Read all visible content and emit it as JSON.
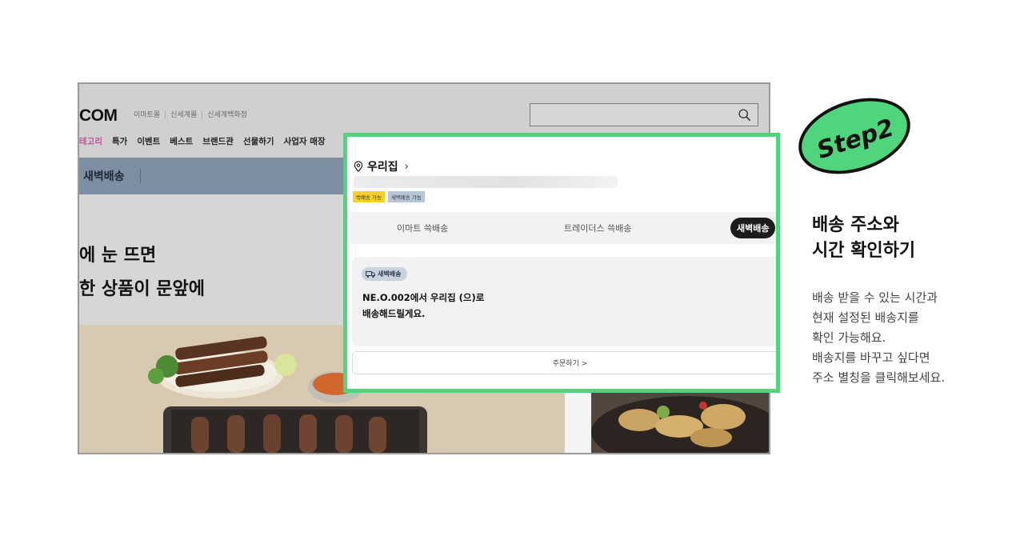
{
  "site": {
    "logo": "COM",
    "family_links": [
      "이마트몰",
      "신세계몰",
      "신세계백화점"
    ],
    "gnb": [
      "테고리",
      "특가",
      "이벤트",
      "베스트",
      "브랜드관",
      "선물하기",
      "사업자 매장"
    ],
    "subbar_label": "새벽배송",
    "hero_line1": "에 눈 뜨면",
    "hero_line2": "한 상품이 문앞에"
  },
  "modal": {
    "address_title": "우리집",
    "badges": [
      "쓱배송 가능",
      "새벽배송 가능"
    ],
    "tabs": [
      {
        "label": "이마트 쓱배송"
      },
      {
        "label": "트레이더스 쓱배송"
      },
      {
        "label": "새벽배송",
        "active": true
      }
    ],
    "chip_label": "새벽배송",
    "message_line1": "NE.O.002에서 우리집 (으)로",
    "message_line2": "배송해드릴게요.",
    "order_button": "주문하기 >"
  },
  "step": {
    "label": "Step2",
    "color": "#4fd67c"
  },
  "info": {
    "heading_line1": "배송 주소와",
    "heading_line2": "시간 확인하기",
    "desc_lines": [
      "배송 받을 수 있는 시간과",
      "현재 설정된 배송지를",
      "확인 가능해요.",
      "배송지를 바꾸고 싶다면",
      "주소 별칭을 클릭해보세요."
    ]
  },
  "colors": {
    "highlight": "#4fd67c",
    "subbar": "#7d8da2",
    "badge_yellow": "#f7cf2f",
    "badge_blue": "#b6c6d8"
  }
}
